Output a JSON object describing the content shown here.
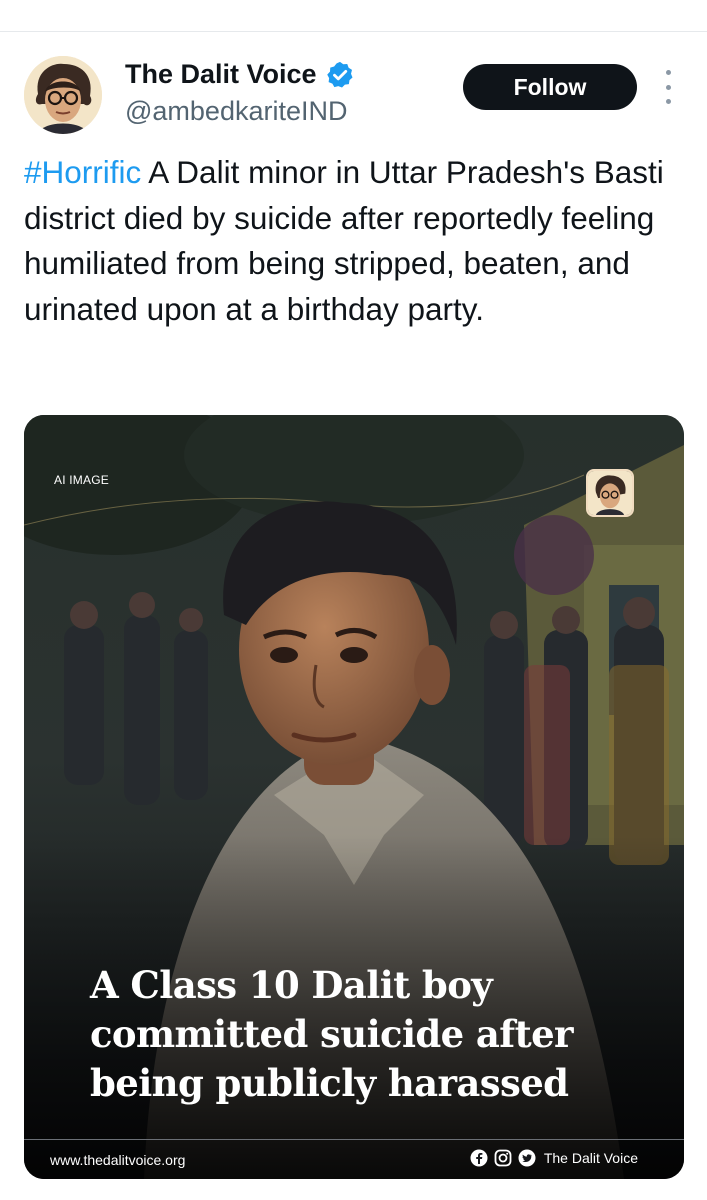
{
  "account": {
    "display_name": "The Dalit Voice",
    "handle": "@ambedkariteIND",
    "verified": true,
    "follow_label": "Follow"
  },
  "tweet": {
    "hashtag": "#Horrific",
    "body": " A Dalit minor in Uttar Pradesh's Basti district died by suicide after reportedly feeling humiliated from being stripped, beaten, and urinated upon at a birthday party."
  },
  "media": {
    "ai_label": "AI IMAGE",
    "headline": "A Class 10 Dalit boy committed suicide after being publicly harassed",
    "site_url": "www.thedalitvoice.org",
    "brand": "The Dalit Voice",
    "social_icons": [
      "facebook-icon",
      "instagram-icon",
      "twitter-icon"
    ]
  },
  "colors": {
    "link": "#1d9bf0",
    "verified_badge": "#1d9bf0",
    "follow_bg": "#0f1419"
  }
}
